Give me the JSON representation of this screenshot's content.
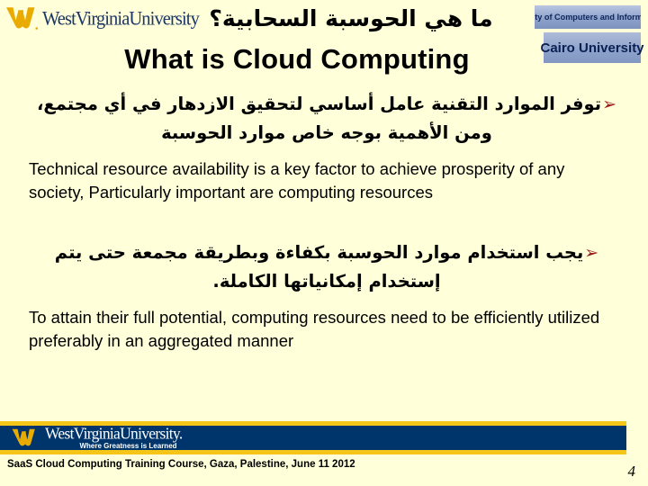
{
  "slide": {
    "background_color": "#ffffd9",
    "title_arabic": "ما هي الحوسبة السحابية؟",
    "title_english": "What is Cloud Computing"
  },
  "logos": {
    "wvu_top": {
      "name": "west-virginia-university-logo",
      "wordmark": "WestVirginiaUniversity",
      "mark_color": "#eaab00",
      "text_color": "#1b3668"
    },
    "cairo": {
      "name": "cairo-university-logo",
      "line1": "Faculty of Computers and Information",
      "line2_part1": "C",
      "line2_part2": "airo ",
      "line2_part3": "U",
      "line2_part4": "niversity",
      "line2_full": "Cairo University",
      "text_color": "#10265c",
      "band_color": "#8ea3cb"
    },
    "wvu_footer": {
      "name": "west-virginia-university-footer-logo",
      "wordmark": "WestVirginiaUniversity.",
      "tagline_where": "Where",
      "tagline_greatness": "Greatness",
      "tagline_is": "is",
      "tagline_learned": "Learned",
      "tagline_full": "Where Greatness is Learned",
      "bar_color": "#00356b",
      "stripe_color": "#f5c518",
      "mark_color": "#eaab00"
    }
  },
  "content": {
    "bullet_glyph": "➢",
    "bullet_color": "#9e1b1b",
    "blocks": [
      {
        "lang": "ar",
        "text": "توفر الموارد التقنية عامل أساسي لتحقيق الازدهار في أي مجتمع، ومن الأهمية بوجه خاص موارد الحوسبة"
      },
      {
        "lang": "en",
        "text": "Technical resource availability is a key factor to achieve prosperity of any society, Particularly important are computing resources"
      },
      {
        "lang": "ar",
        "text": "يجب استخدام موارد الحوسبة بكفاءة وبطريقة مجمعة  حتى يتم إستخدام إمكانياتها الكاملة."
      },
      {
        "lang": "en",
        "text": "To attain their full potential, computing resources need to be efficiently utilized preferably in an aggregated manner"
      }
    ]
  },
  "footer": {
    "caption": "SaaS Cloud Computing Training Course, Gaza, Palestine, June 11 2012",
    "page_number": "4"
  }
}
